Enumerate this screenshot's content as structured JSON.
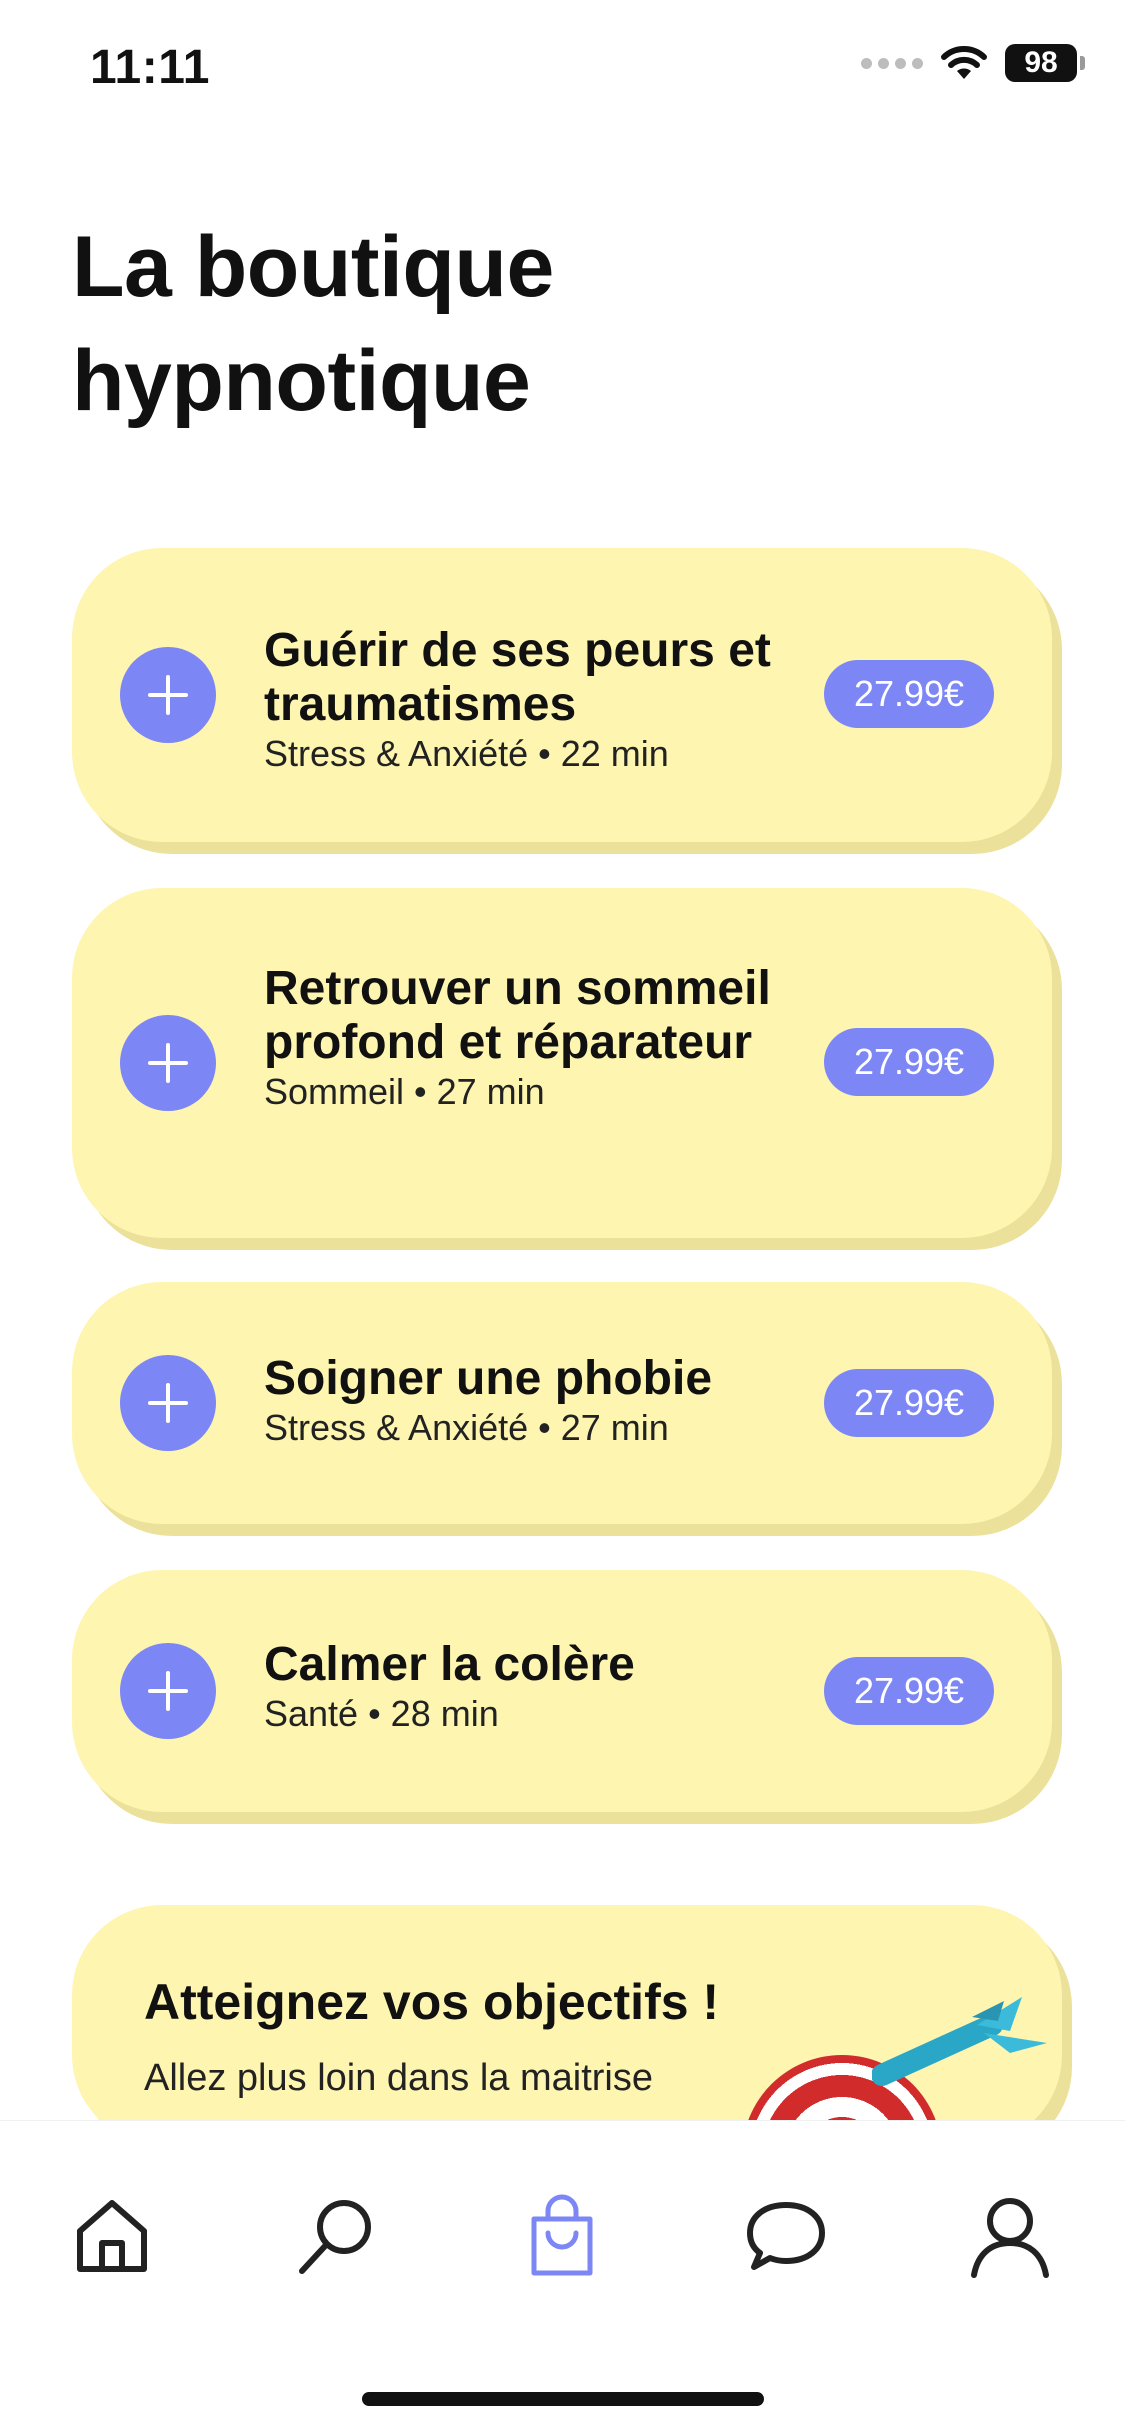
{
  "status_bar": {
    "time": "11:11",
    "battery": "98"
  },
  "page": {
    "title": "La boutique hypnotique"
  },
  "products": [
    {
      "title": "Guérir de ses peurs et traumatismes",
      "meta": "Stress & Anxiété • 22 min",
      "price": "27.99€"
    },
    {
      "title": "Retrouver un sommeil profond et réparateur",
      "meta": "Sommeil • 27 min",
      "price": "27.99€"
    },
    {
      "title": "Soigner une phobie",
      "meta": "Stress & Anxiété • 27 min",
      "price": "27.99€"
    },
    {
      "title": "Calmer la colère",
      "meta": "Santé • 28 min",
      "price": "27.99€"
    }
  ],
  "promo": {
    "title": "Atteignez vos objectifs !",
    "text": "Allez plus loin dans la maitrise"
  },
  "nav": {
    "items": [
      {
        "icon": "home-icon",
        "active": false
      },
      {
        "icon": "search-icon",
        "active": false
      },
      {
        "icon": "shopping-bag-icon",
        "active": true
      },
      {
        "icon": "chat-icon",
        "active": false
      },
      {
        "icon": "profile-icon",
        "active": false
      }
    ]
  },
  "colors": {
    "card_background": "#fdf5b0",
    "accent": "#7c87f5",
    "nav_inactive": "#222222"
  }
}
